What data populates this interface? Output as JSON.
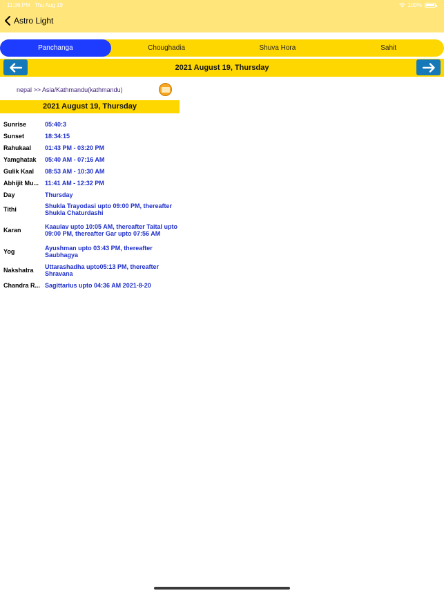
{
  "status_bar": {
    "time": "11:36 PM",
    "date": "Thu Aug 19",
    "battery": "100%"
  },
  "nav": {
    "back_label": "Astro Light"
  },
  "tabs": [
    {
      "label": "Panchanga",
      "active": true
    },
    {
      "label": "Choughadia",
      "active": false
    },
    {
      "label": "Shuva Hora",
      "active": false
    },
    {
      "label": "Sahit",
      "active": false
    }
  ],
  "date_nav": {
    "title": "2021 August 19, Thursday"
  },
  "location": {
    "text": "nepal >> Asia/Kathmandu(kathmandu)"
  },
  "banner": {
    "title": "2021 August 19, Thursday"
  },
  "panchanga": [
    {
      "key": "Sunrise",
      "value": "05:40:3"
    },
    {
      "key": "Sunset",
      "value": "18:34:15"
    },
    {
      "key": "Rahukaal",
      "value": "01:43 PM - 03:20 PM"
    },
    {
      "key": "Yamghatak",
      "value": "05:40 AM - 07:16 AM"
    },
    {
      "key": "Gulik Kaal",
      "value": "08:53 AM - 10:30 AM"
    },
    {
      "key": "Abhijit Mu...",
      "value": "11:41 AM - 12:32 PM"
    },
    {
      "key": "Day",
      "value": "Thursday"
    },
    {
      "key": "Tithi",
      "value": "Shukla Trayodasi upto 09:00 PM, thereafter Shukla Chaturdashi"
    },
    {
      "key": "Karan",
      "value": "Kaaulav upto 10:05 AM, thereafter Taital upto 09:00 PM, thereafter Gar upto 07:56 AM"
    },
    {
      "key": "Yog",
      "value": "Ayushman upto 03:43 PM, thereafter Saubhagya"
    },
    {
      "key": "Nakshatra",
      "value": "Uttarashadha upto05:13 PM, thereafter Shravana"
    },
    {
      "key": "Chandra R...",
      "value": "Sagittarius upto 04:36 AM 2021-8-20"
    }
  ],
  "colors": {
    "header_bg": "#FFE57A",
    "accent_yellow": "#FFD700",
    "active_tab": "#1E3CFF",
    "arrow_button": "#1578B8",
    "value_text": "#1E2FC8"
  }
}
